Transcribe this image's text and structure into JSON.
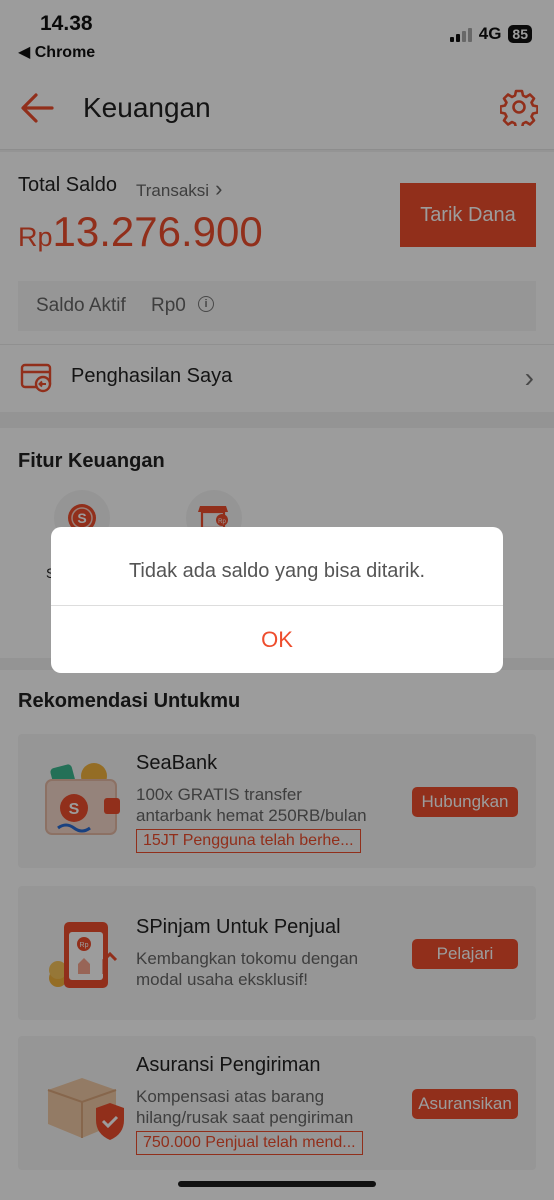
{
  "status_bar": {
    "time": "14.38",
    "back_app": "Chrome",
    "network": "4G",
    "battery": "85"
  },
  "header": {
    "title": "Keuangan",
    "back_icon": "arrow-left-icon",
    "settings_icon": "gear-icon"
  },
  "balance": {
    "label": "Total Saldo",
    "transactions_link": "Transaksi",
    "currency": "Rp",
    "amount": "13.276.900",
    "withdraw_button": "Tarik Dana",
    "active_label": "Saldo Aktif",
    "active_value": "Rp0"
  },
  "income": {
    "label": "Penghasilan Saya"
  },
  "features": {
    "title": "Fitur Keuangan",
    "items": [
      {
        "label": "S",
        "icon": "shopeepay-icon"
      },
      {
        "label": "",
        "icon": "store-rp-icon"
      }
    ]
  },
  "recommendations": {
    "title": "Rekomendasi Untukmu",
    "cards": [
      {
        "title": "SeaBank",
        "desc_line1": "100x GRATIS transfer",
        "desc_line2": "antarbank hemat 250RB/bulan",
        "badge": "15JT Pengguna telah berhe...",
        "button": "Hubungkan"
      },
      {
        "title": "SPinjam Untuk Penjual",
        "desc_line1": "Kembangkan tokomu dengan",
        "desc_line2": "modal usaha eksklusif!",
        "badge": "",
        "button": "Pelajari"
      },
      {
        "title": "Asuransi Pengiriman",
        "desc_line1": "Kompensasi atas barang",
        "desc_line2": "hilang/rusak saat pengiriman",
        "badge": "750.000 Penjual telah mend...",
        "button": "Asuransikan"
      }
    ]
  },
  "dialog": {
    "message": "Tidak ada saldo yang bisa ditarik.",
    "ok": "OK"
  },
  "colors": {
    "accent": "#ee4d2d"
  }
}
